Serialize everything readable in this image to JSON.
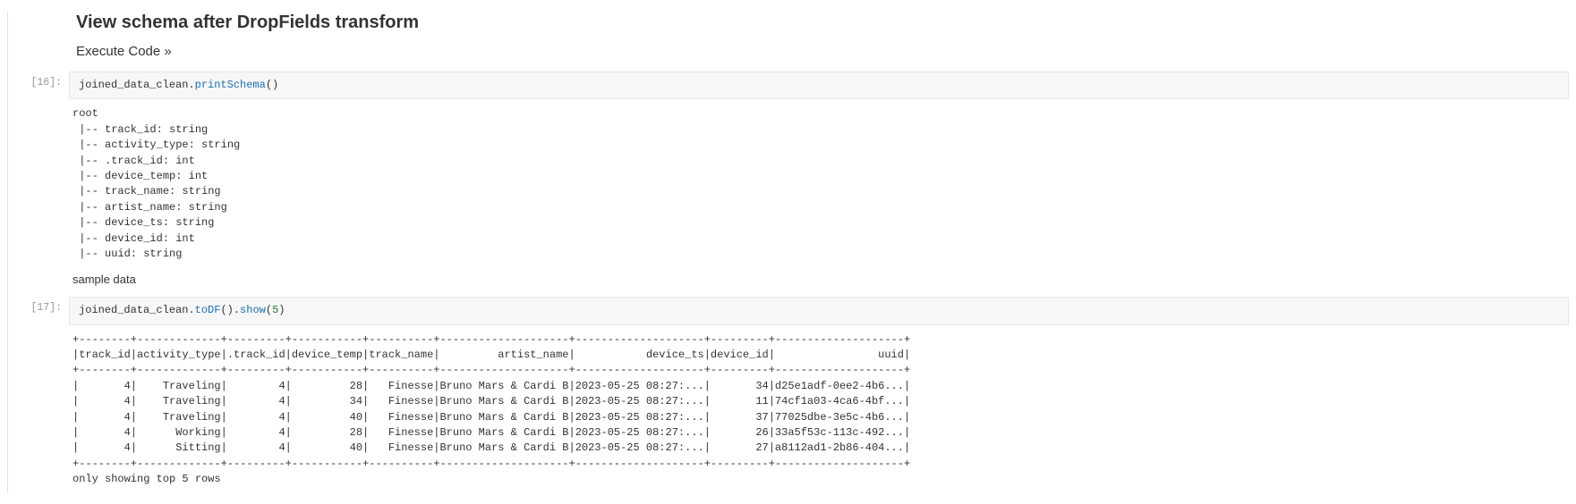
{
  "title": "View schema after DropFields transform",
  "subtitle": "Execute Code »",
  "cells": {
    "c16": {
      "prompt": "[16]:",
      "code": {
        "obj": "joined_data_clean",
        "method": "printSchema",
        "args": "()"
      },
      "output": "root\n |-- track_id: string\n |-- activity_type: string\n |-- .track_id: int\n |-- device_temp: int\n |-- track_name: string\n |-- artist_name: string\n |-- device_ts: string\n |-- device_id: int\n |-- uuid: string"
    },
    "sample_label": "sample data",
    "c17": {
      "prompt": "[17]:",
      "code": {
        "obj": "joined_data_clean",
        "method1": "toDF",
        "args1": "()",
        "method2": "show",
        "args2_open": "(",
        "args2_num": "5",
        "args2_close": ")"
      },
      "output": "+--------+-------------+---------+-----------+----------+--------------------+--------------------+---------+--------------------+\n|track_id|activity_type|.track_id|device_temp|track_name|         artist_name|           device_ts|device_id|                uuid|\n+--------+-------------+---------+-----------+----------+--------------------+--------------------+---------+--------------------+\n|       4|    Traveling|        4|         28|   Finesse|Bruno Mars & Cardi B|2023-05-25 08:27:...|       34|d25e1adf-0ee2-4b6...|\n|       4|    Traveling|        4|         34|   Finesse|Bruno Mars & Cardi B|2023-05-25 08:27:...|       11|74cf1a03-4ca6-4bf...|\n|       4|    Traveling|        4|         40|   Finesse|Bruno Mars & Cardi B|2023-05-25 08:27:...|       37|77025dbe-3e5c-4b6...|\n|       4|      Working|        4|         28|   Finesse|Bruno Mars & Cardi B|2023-05-25 08:27:...|       26|33a5f53c-113c-492...|\n|       4|      Sitting|        4|         40|   Finesse|Bruno Mars & Cardi B|2023-05-25 08:27:...|       27|a8112ad1-2b86-404...|\n+--------+-------------+---------+-----------+----------+--------------------+--------------------+---------+--------------------+\nonly showing top 5 rows"
    }
  }
}
